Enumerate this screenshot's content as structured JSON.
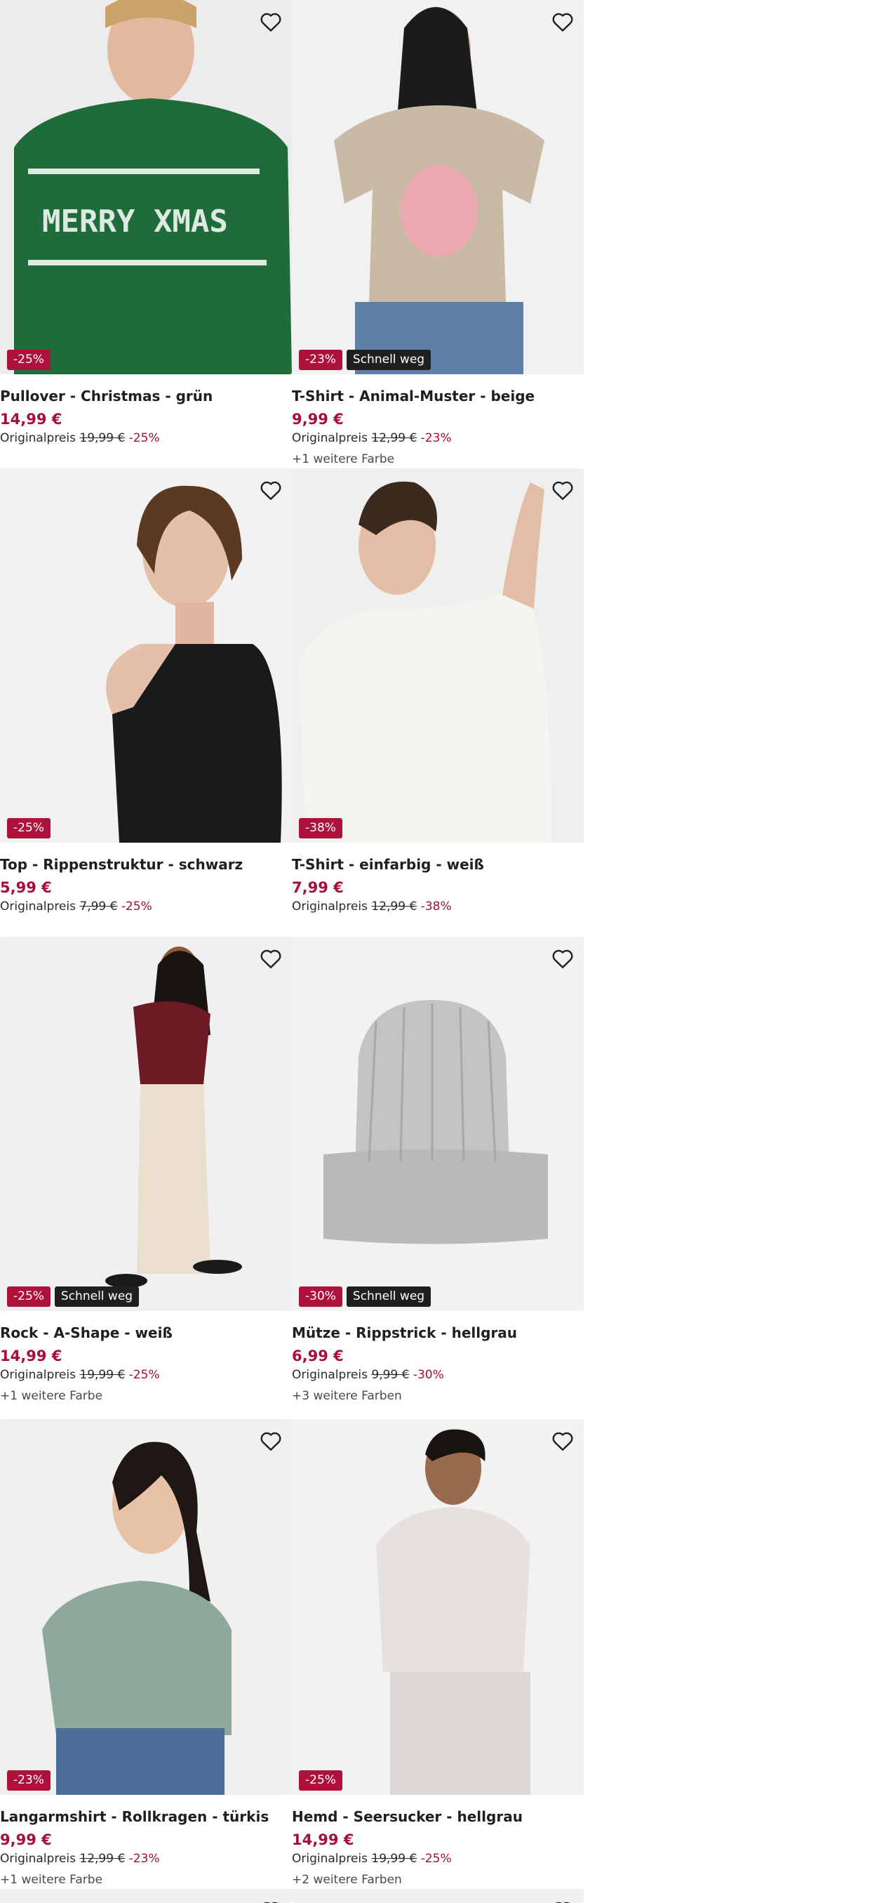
{
  "colors": {
    "accent": "#a50f38",
    "badge_discount": "#b0103c",
    "badge_fast": "#1f1f1f",
    "image_bg": "#f0f0f0"
  },
  "icons": {
    "wishlist": "heart-icon"
  },
  "products": [
    {
      "name": "Pullover - Christmas - grün",
      "price": "14,99 €",
      "orig_label": "Originalpreis",
      "orig_price": "19,99 €",
      "discount": "-25%",
      "badge_discount": "-25%",
      "badge_fast": "",
      "more_colors": ""
    },
    {
      "name": "T-Shirt - Animal-Muster - beige",
      "price": "9,99 €",
      "orig_label": "Originalpreis",
      "orig_price": "12,99 €",
      "discount": "-23%",
      "badge_discount": "-23%",
      "badge_fast": "Schnell weg",
      "more_colors": "+1 weitere Farbe"
    },
    {
      "name": "Top - Rippenstruktur - schwarz",
      "price": "5,99 €",
      "orig_label": "Originalpreis",
      "orig_price": "7,99 €",
      "discount": "-25%",
      "badge_discount": "-25%",
      "badge_fast": "",
      "more_colors": ""
    },
    {
      "name": "T-Shirt - einfarbig - weiß",
      "price": "7,99 €",
      "orig_label": "Originalpreis",
      "orig_price": "12,99 €",
      "discount": "-38%",
      "badge_discount": "-38%",
      "badge_fast": "",
      "more_colors": ""
    },
    {
      "name": "Rock - A-Shape - weiß",
      "price": "14,99 €",
      "orig_label": "Originalpreis",
      "orig_price": "19,99 €",
      "discount": "-25%",
      "badge_discount": "-25%",
      "badge_fast": "Schnell weg",
      "more_colors": "+1 weitere Farbe"
    },
    {
      "name": "Mütze - Rippstrick - hellgrau",
      "price": "6,99 €",
      "orig_label": "Originalpreis",
      "orig_price": "9,99 €",
      "discount": "-30%",
      "badge_discount": "-30%",
      "badge_fast": "Schnell weg",
      "more_colors": "+3 weitere Farben"
    },
    {
      "name": "Langarmshirt - Rollkragen - türkis",
      "price": "9,99 €",
      "orig_label": "Originalpreis",
      "orig_price": "12,99 €",
      "discount": "-23%",
      "badge_discount": "-23%",
      "badge_fast": "",
      "more_colors": "+1 weitere Farbe"
    },
    {
      "name": "Hemd - Seersucker - hellgrau",
      "price": "14,99 €",
      "orig_label": "Originalpreis",
      "orig_price": "19,99 €",
      "discount": "-25%",
      "badge_discount": "-25%",
      "badge_fast": "",
      "more_colors": "+2 weitere Farben"
    }
  ]
}
